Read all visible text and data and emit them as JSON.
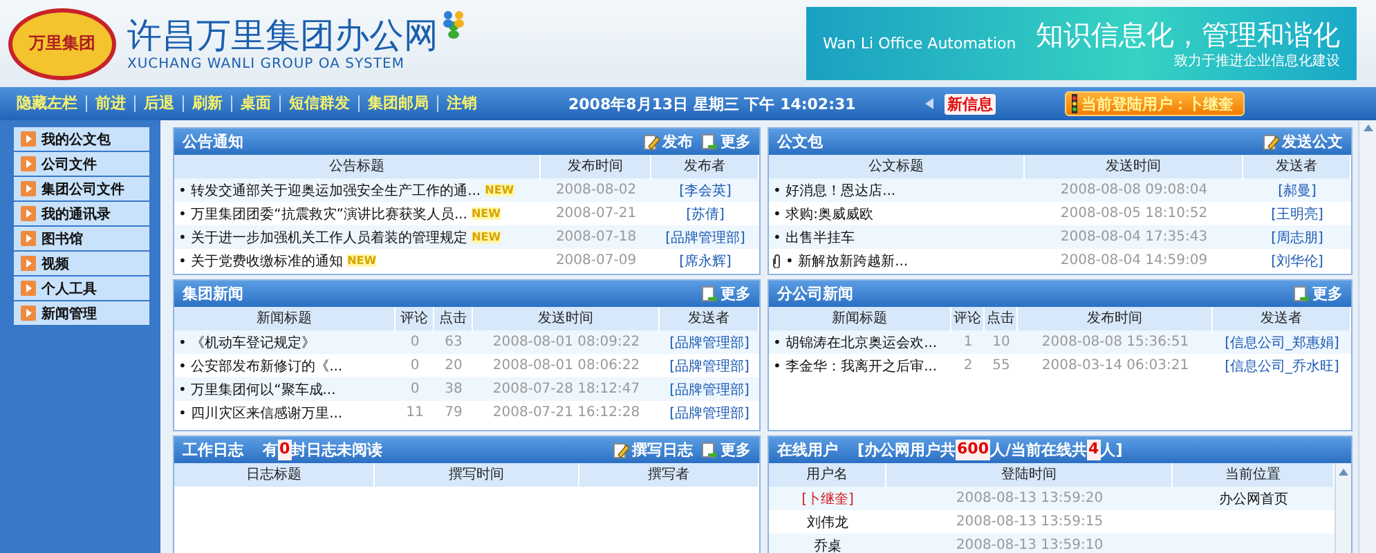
{
  "header": {
    "logo_text": "万里集团",
    "title": "许昌万里集团办公网",
    "subtitle": "XUCHANG WANLI GROUP OA SYSTEM",
    "banner": {
      "tagline": "Wan Li Office Automation",
      "slogan": "知识信息化，管理和谐化",
      "sub_slogan": "致力于推进企业信息化建设"
    }
  },
  "navbar": {
    "items": [
      "隐藏左栏",
      "前进",
      "后退",
      "刷新",
      "桌面",
      "短信群发",
      "集团邮局",
      "注销"
    ],
    "datetime": "2008年8月13日 星期三 下午 14:02:31",
    "new_message": "新信息",
    "current_user": "当前登陆用户：卜继奎"
  },
  "sidebar": {
    "items": [
      {
        "label": "我的公文包"
      },
      {
        "label": "公司文件"
      },
      {
        "label": "集团公司文件"
      },
      {
        "label": "我的通讯录"
      },
      {
        "label": "图书馆"
      },
      {
        "label": "视频"
      },
      {
        "label": "个人工具"
      },
      {
        "label": "新闻管理"
      }
    ]
  },
  "panels": [
    {
      "kind": "notice",
      "title": "公告通知",
      "actions": [
        {
          "label": "发布",
          "kind": "edit"
        },
        {
          "label": "更多",
          "kind": "more"
        }
      ],
      "columns": [
        "公告标题",
        "发布时间",
        "发布者"
      ],
      "rows": [
        {
          "cells": [
            "• 转发交通部关于迎奥运加强安全生产工作的通...",
            "2008-08-02",
            "[李会英]"
          ],
          "badge": "NEW"
        },
        {
          "cells": [
            "• 万里集团团委“抗震救灾”演讲比赛获奖人员...",
            "2008-07-21",
            "[苏倩]"
          ],
          "badge": "NEW"
        },
        {
          "cells": [
            "• 关于进一步加强机关工作人员着装的管理规定",
            "2008-07-18",
            "[品牌管理部]"
          ],
          "badge": "NEW"
        },
        {
          "cells": [
            "• 关于党费收缴标准的通知",
            "2008-07-09",
            "[席永辉]"
          ],
          "badge": "NEW"
        }
      ]
    },
    {
      "kind": "docs",
      "title": "公文包",
      "actions": [
        {
          "label": "发送公文",
          "kind": "edit"
        }
      ],
      "columns": [
        "公文标题",
        "发送时间",
        "发送者"
      ],
      "rows": [
        {
          "cells": [
            "• 好消息！恩达店...",
            "2008-08-08 09:08:04",
            "[郝曼]"
          ]
        },
        {
          "cells": [
            "• 求购:奥威威欧",
            "2008-08-05 18:10:52",
            "[王明亮]"
          ]
        },
        {
          "cells": [
            "• 出售半挂车",
            "2008-08-04 17:35:43",
            "[周志朋]"
          ]
        },
        {
          "cells": [
            "• 新解放新跨越新...",
            "2008-08-04 14:59:09",
            "[刘华伦]"
          ],
          "attachment": true
        }
      ]
    },
    {
      "kind": "news",
      "title": "集团新闻",
      "actions": [
        {
          "label": "更多",
          "kind": "more"
        }
      ],
      "columns": [
        "新闻标题",
        "评论",
        "点击",
        "发送时间",
        "发送者"
      ],
      "rows": [
        {
          "cells": [
            "• 《机动车登记规定》",
            "0",
            "63",
            "2008-08-01 08:09:22",
            "[品牌管理部]"
          ]
        },
        {
          "cells": [
            "• 公安部发布新修订的《...",
            "0",
            "20",
            "2008-08-01 08:06:22",
            "[品牌管理部]"
          ]
        },
        {
          "cells": [
            "• 万里集团何以“聚车成...",
            "0",
            "38",
            "2008-07-28 18:12:47",
            "[品牌管理部]"
          ]
        },
        {
          "cells": [
            "• 四川灾区来信感谢万里...",
            "11",
            "79",
            "2008-07-21 16:12:28",
            "[品牌管理部]"
          ]
        }
      ]
    },
    {
      "kind": "branch_news",
      "title": "分公司新闻",
      "actions": [
        {
          "label": "更多",
          "kind": "more"
        }
      ],
      "columns": [
        "新闻标题",
        "评论",
        "点击",
        "发布时间",
        "发送者"
      ],
      "rows": [
        {
          "cells": [
            "• 胡锦涛在北京奥运会欢...",
            "1",
            "10",
            "2008-08-08 15:36:51",
            "[信息公司_郑惠娟]"
          ]
        },
        {
          "cells": [
            "• 李金华：我离开之后审...",
            "2",
            "55",
            "2008-03-14 06:03:21",
            "[信息公司_乔水旺]"
          ]
        }
      ]
    },
    {
      "kind": "log",
      "title": "工作日志",
      "note": [
        {
          "text": "有",
          "highlight": false
        },
        {
          "text": "0",
          "highlight": true
        },
        {
          "text": "封日志未阅读",
          "highlight": false
        }
      ],
      "actions": [
        {
          "label": "撰写日志",
          "kind": "edit"
        },
        {
          "label": "更多",
          "kind": "more"
        }
      ],
      "columns": [
        "日志标题",
        "撰写时间",
        "撰写者"
      ]
    },
    {
      "kind": "online",
      "title": "在线用户",
      "note": [
        {
          "text": "[办公网用户共",
          "highlight": false
        },
        {
          "text": "600",
          "highlight": true
        },
        {
          "text": "人/当前在线共",
          "highlight": false
        },
        {
          "text": "4",
          "highlight": true
        },
        {
          "text": "人]",
          "highlight": false
        }
      ],
      "columns": [
        "用户名",
        "登陆时间",
        "当前位置"
      ],
      "rows": [
        {
          "cells": [
            "[卜继奎]",
            "2008-08-13 13:59:20",
            "办公网首页"
          ],
          "current": true
        },
        {
          "cells": [
            "刘伟龙",
            "2008-08-13 13:59:15",
            ""
          ],
          "current": false
        },
        {
          "cells": [
            "乔桌",
            "2008-08-13 13:59:10",
            ""
          ],
          "current": false
        }
      ]
    }
  ]
}
